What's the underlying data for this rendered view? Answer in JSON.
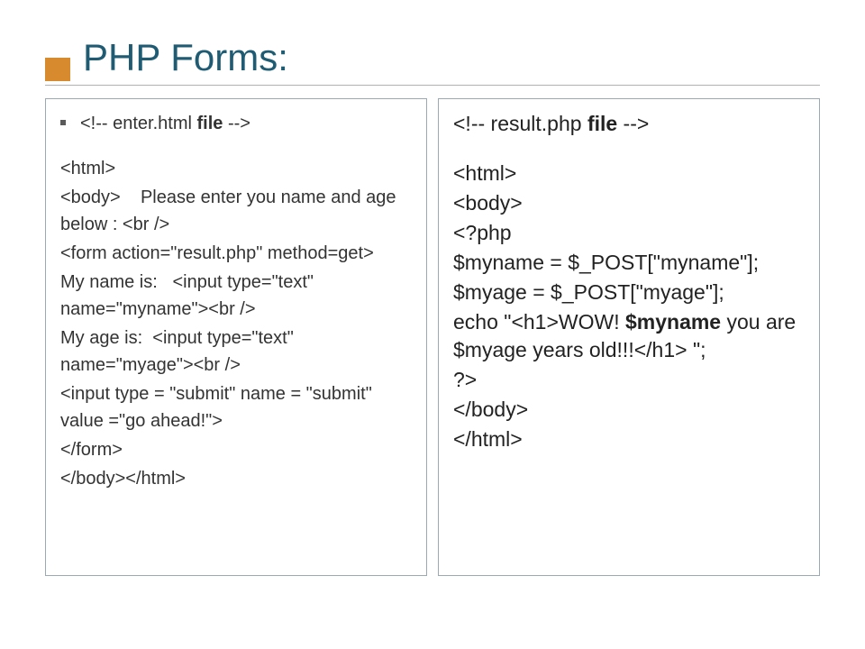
{
  "title": "PHP Forms:",
  "left": {
    "bullet": "<!-- enter.html file -->",
    "l1": "<html>",
    "l2a": "<body>",
    "l2b": "Please enter you name and age below : <br />",
    "l3": "<form action=\"result.php\" method=get>",
    "l4a": "My name is:",
    "l4b": "<input type=\"text\" name=\"myname\"><br />",
    "l5a": " My age is:",
    "l5b": "<input type=\"text\" name=\"myage\"><br />",
    "l6": "<input type = \"submit\" name = \"submit\" value =\"go ahead!\">",
    "l7": "</form>",
    "l8": "</body></html>"
  },
  "right": {
    "r1a": "<!-- result.php ",
    "r1b": "file",
    "r1c": " -->",
    "r2": "<html>",
    "r3": "<body>",
    "r4": "<?php",
    "r5": "$myname = $_POST[\"myname\"];",
    "r6": "$myage = $_POST[\"myage\"];",
    "r7a": "echo \"",
    "r7b": "<h1>",
    "r7c": "WOW! $myname",
    "r7d": " you are $myage years old!!!",
    "r7e": "</h1>",
    "r7f": " \";",
    "r8": "?>",
    "r9": "</body>",
    "r10": "</html>"
  }
}
